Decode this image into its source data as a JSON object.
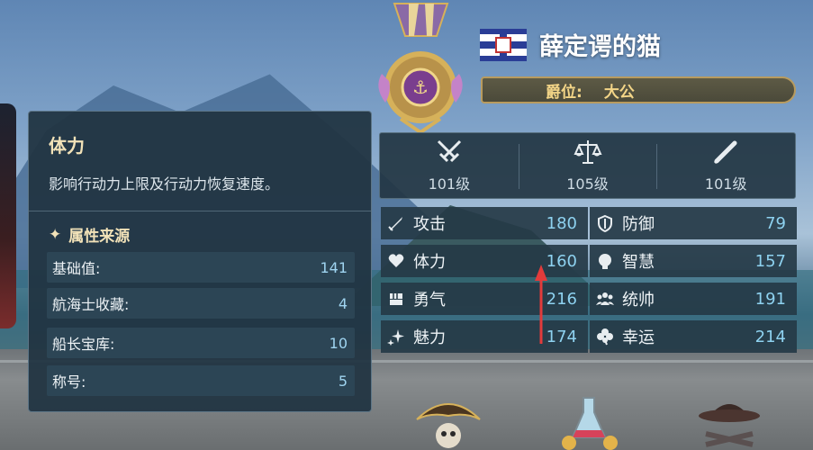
{
  "player": {
    "name": "薛定谔的猫"
  },
  "rank": {
    "label": "爵位:",
    "value": "大公"
  },
  "tooltip": {
    "title": "体力",
    "description": "影响行动力上限及行动力恢复速度。",
    "sources_header": "属性来源",
    "sources": [
      {
        "label": "基础值:",
        "value": "141"
      },
      {
        "label": "航海士收藏:",
        "value": "4"
      },
      {
        "label": "船长宝库:",
        "value": "10"
      },
      {
        "label": "称号:",
        "value": "5"
      }
    ]
  },
  "levels": [
    {
      "icon": "crossed-swords-icon",
      "text": "101级"
    },
    {
      "icon": "scales-icon",
      "text": "105级"
    },
    {
      "icon": "telescope-icon",
      "text": "101级"
    }
  ],
  "stats": {
    "attack": {
      "label": "攻击",
      "value": "180",
      "icon": "sword-icon"
    },
    "defense": {
      "label": "防御",
      "value": "79",
      "icon": "shield-icon"
    },
    "stamina": {
      "label": "体力",
      "value": "160",
      "icon": "heart-icon"
    },
    "wisdom": {
      "label": "智慧",
      "value": "157",
      "icon": "brain-head-icon"
    },
    "courage": {
      "label": "勇气",
      "value": "216",
      "icon": "fist-icon"
    },
    "leadership": {
      "label": "统帅",
      "value": "191",
      "icon": "people-icon"
    },
    "charm": {
      "label": "魅力",
      "value": "174",
      "icon": "sparkle-icon"
    },
    "luck": {
      "label": "幸运",
      "value": "214",
      "icon": "clover-icon"
    }
  },
  "colors": {
    "accent_gold": "#f2e2b8",
    "value_blue": "#8ed2f0",
    "arrow_red": "#e23b3b"
  }
}
